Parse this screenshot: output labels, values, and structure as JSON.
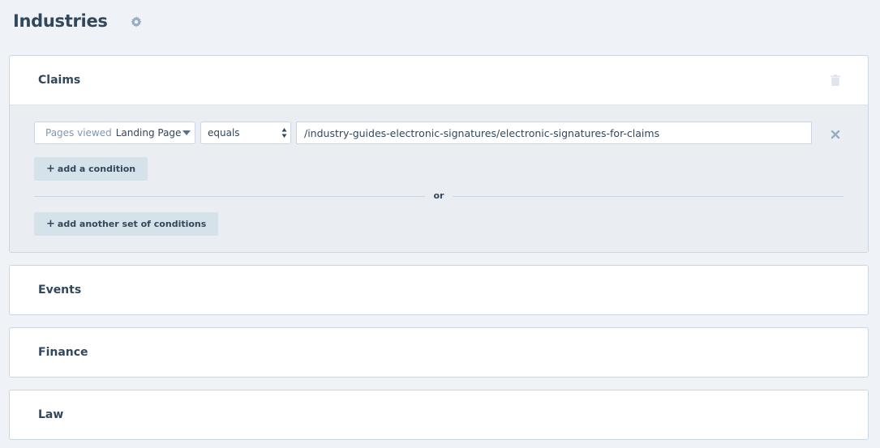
{
  "page": {
    "title": "Industries"
  },
  "icons": {
    "settings": "gear-icon",
    "delete": "trash-icon",
    "remove": "close-icon"
  },
  "colors": {
    "text": "#33475b",
    "muted": "#7c98b6",
    "border": "#cbd6e2",
    "button_bg": "#d6e2ea",
    "body_bg": "#eff2f6"
  },
  "groups": [
    {
      "name": "Claims",
      "expanded": true,
      "conditions": [
        {
          "property_prefix": "Pages viewed",
          "property_value": "Landing Page",
          "operator": "equals",
          "value": "/industry-guides-electronic-signatures/electronic-signatures-for-claims"
        }
      ],
      "add_condition_label": "add a condition",
      "or_label": "or",
      "add_set_label": "add another set of conditions"
    },
    {
      "name": "Events",
      "expanded": false
    },
    {
      "name": "Finance",
      "expanded": false
    },
    {
      "name": "Law",
      "expanded": false
    }
  ]
}
